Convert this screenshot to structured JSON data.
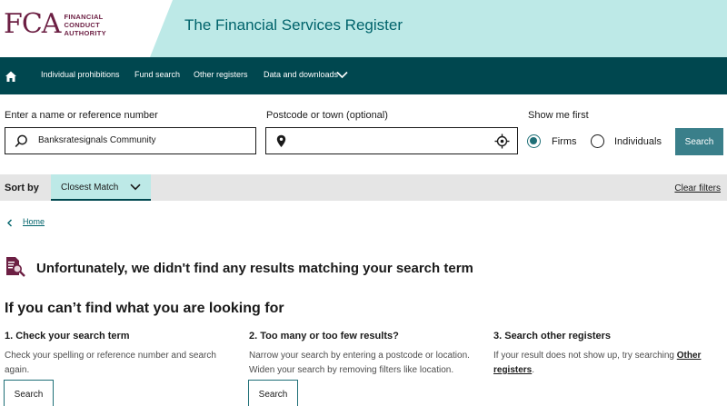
{
  "header": {
    "logo_mark": "FCA",
    "logo_lines": [
      "FINANCIAL",
      "CONDUCT",
      "AUTHORITY"
    ],
    "site_title": "The Financial Services Register"
  },
  "nav": {
    "items": [
      "Individual prohibitions",
      "Fund search",
      "Other registers",
      "Data and downloads"
    ]
  },
  "search": {
    "name_label": "Enter a name or reference number",
    "name_value": "Banksratesignals Community",
    "postcode_label": "Postcode or town (optional)",
    "postcode_value": "",
    "show_me_first_label": "Show me first",
    "radio_firms": "Firms",
    "radio_individuals": "Individuals",
    "selected": "Firms",
    "button": "Search"
  },
  "sort": {
    "label": "Sort by",
    "value": "Closest Match",
    "clear_filters": "Clear filters"
  },
  "breadcrumb": {
    "home": "Home"
  },
  "results": {
    "no_results": "Unfortunately, we didn't find any results matching your search term",
    "help_heading": "If you can’t find what you are looking for"
  },
  "help": {
    "col1_title": "1. Check your search term",
    "col1_text": "Check your spelling or reference number and search again.",
    "col1_button": "Search",
    "col2_title": "2. Too many or too few results?",
    "col2_text1": "Narrow your search by entering a postcode or location.",
    "col2_text2": "Widen your search by removing filters like location.",
    "col2_button": "Search",
    "col3_title": "3. Search other registers",
    "col3_text": "If your result does not show up, try searching ",
    "col3_link": "Other registers",
    "col3_period": "."
  },
  "colors": {
    "header_bg": "#bde9e7",
    "nav_bg": "#00474f",
    "brand": "#6c1f43",
    "accent": "#3a7f8a"
  },
  "icons": [
    "home-icon",
    "chevron-down-icon",
    "search-icon",
    "location-pin-icon",
    "crosshair-icon",
    "document-search-icon",
    "chevron-left-icon"
  ]
}
